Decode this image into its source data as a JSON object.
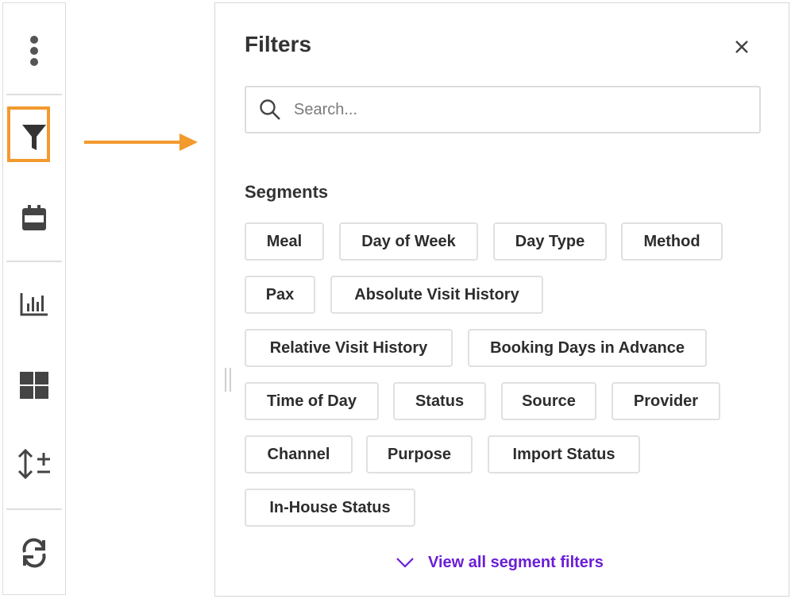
{
  "toolbar": {
    "items": [
      {
        "icon": "more-vertical-icon"
      },
      {
        "icon": "filter-icon"
      },
      {
        "icon": "calendar-icon"
      },
      {
        "icon": "bar-chart-icon"
      },
      {
        "icon": "grid-view-icon"
      },
      {
        "icon": "sort-plus-minus-icon"
      },
      {
        "icon": "refresh-icon"
      }
    ],
    "active_highlight_color": "#f29a2e"
  },
  "arrow": {
    "color": "#f29a2e"
  },
  "panel": {
    "title": "Filters",
    "close_icon": "close-icon",
    "search": {
      "placeholder": "Search...",
      "value": ""
    },
    "section_title": "Segments",
    "chips": [
      "Meal",
      "Day of Week",
      "Day Type",
      "Method",
      "Pax",
      "Absolute Visit History",
      "Relative Visit History",
      "Booking Days in Advance",
      "Time of Day",
      "Status",
      "Source",
      "Provider",
      "Channel",
      "Purpose",
      "Import Status",
      "In-House Status"
    ],
    "view_all_label": "View all segment filters",
    "link_color": "#6a1ed6"
  }
}
